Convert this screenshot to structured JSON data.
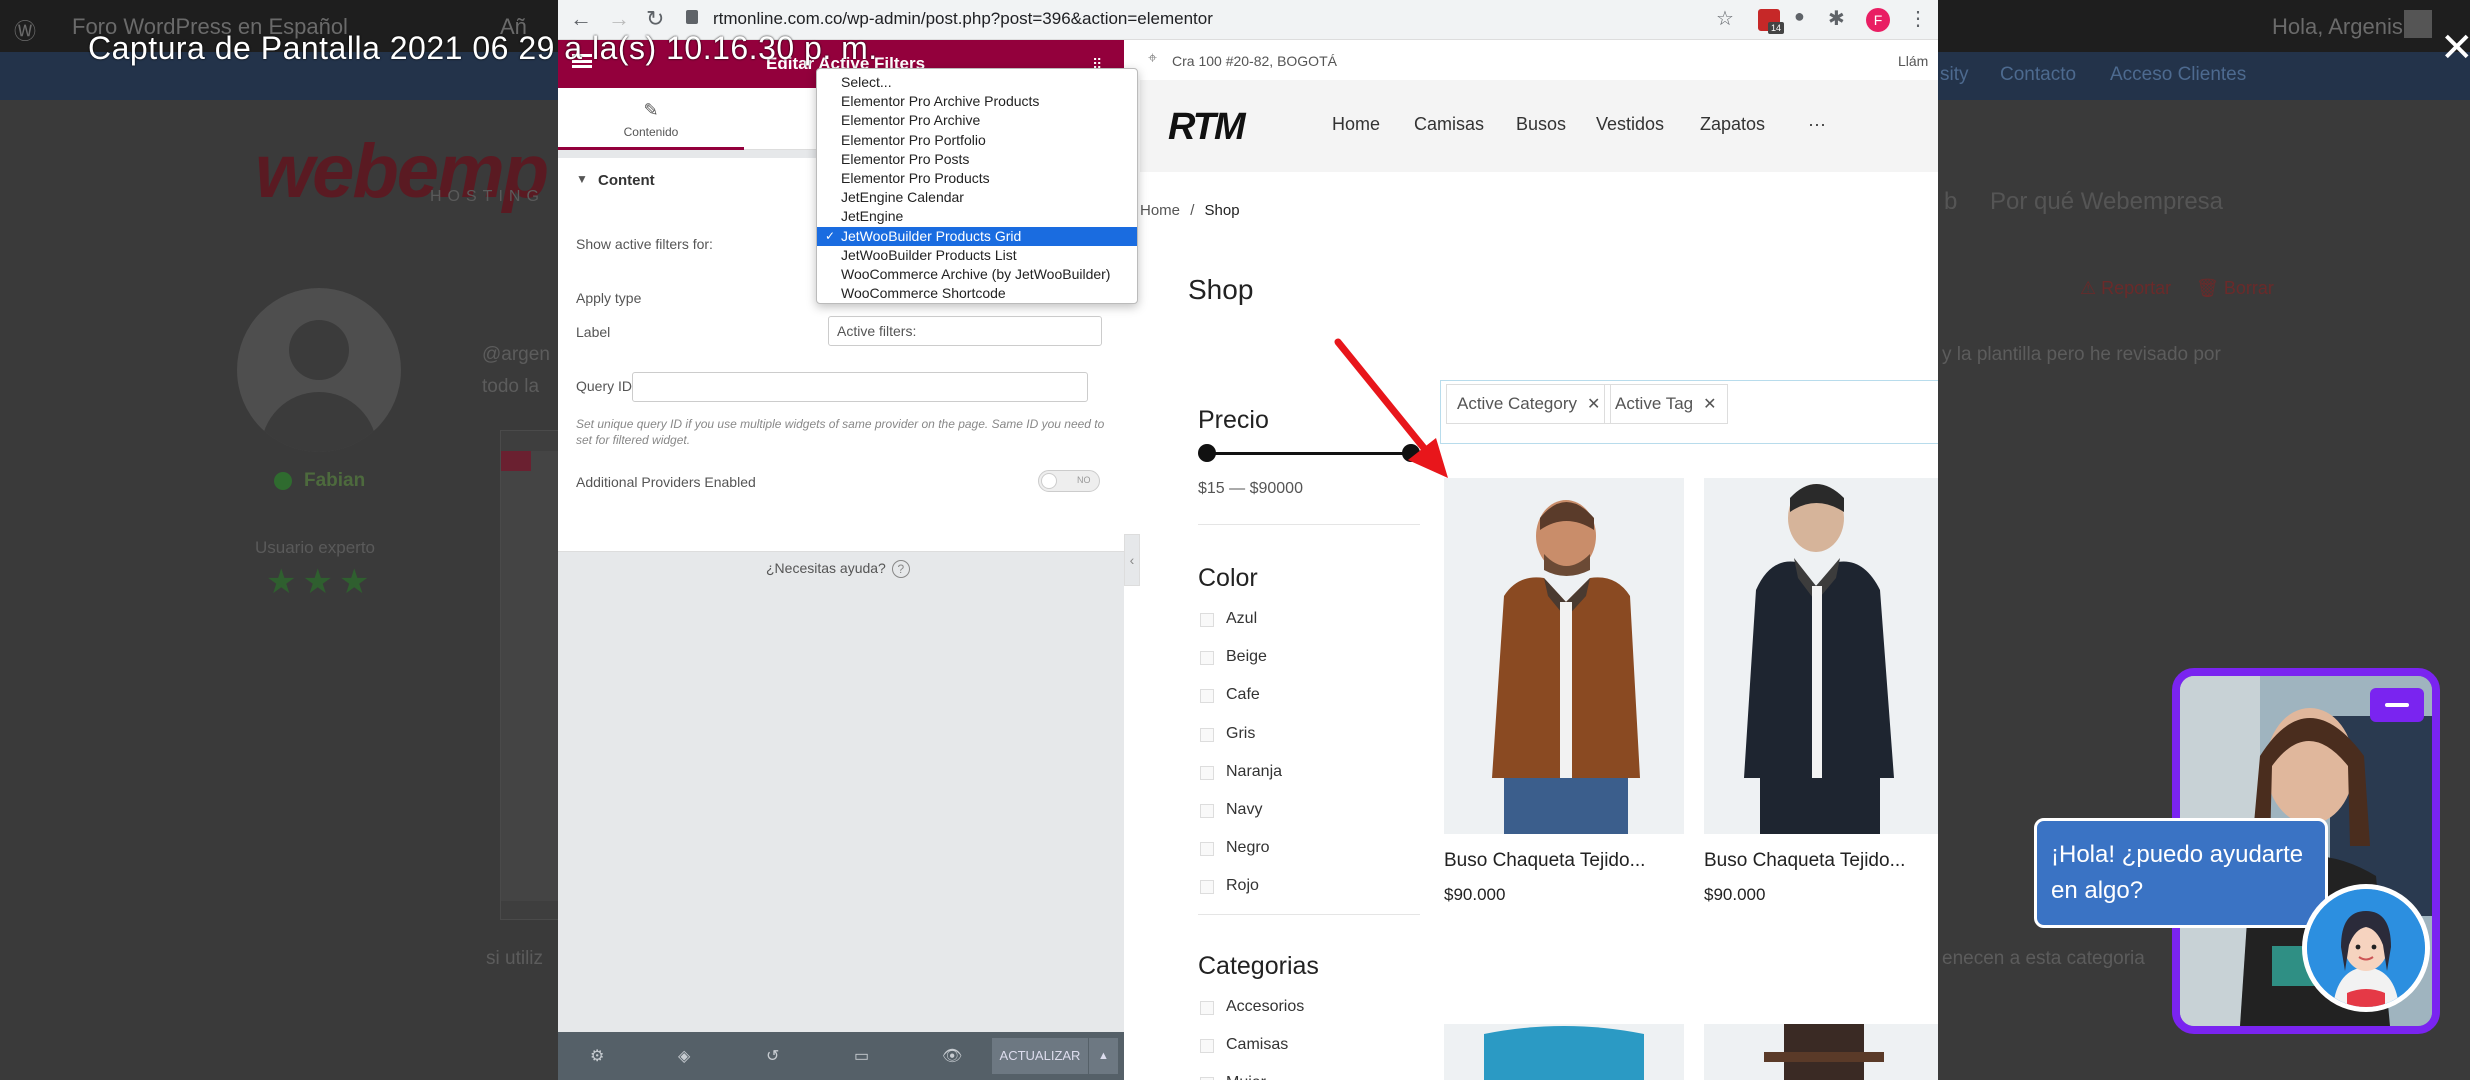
{
  "caption": "Captura de Pantalla 2021 06 29 a la(s) 10.16.30 p. m.",
  "background": {
    "wp_items": [
      "Foro WordPress en Español",
      "Añ"
    ],
    "greeting": "Hola, Argenis",
    "top_links": [
      "sity",
      "Contacto",
      "Acceso Clientes"
    ],
    "logo": "webemp",
    "logo_sub": "HOSTING",
    "menu_right": [
      "b",
      "Por qué Webempresa"
    ],
    "actions": [
      "Reportar",
      "Borrar"
    ],
    "author": "Fabian",
    "role": "Usuario experto",
    "stars": "★★★",
    "post_start": "@argen",
    "post_line2": "todo la",
    "post_right": "y la plantilla pero he revisado por",
    "post_bottom_left": "si utiliz",
    "post_bottom_right": "enecen a esta categoria"
  },
  "browser": {
    "url": "rtmonline.com.co/wp-admin/post.php?post=396&action=elementor"
  },
  "panel": {
    "title": "Editar Active Filters",
    "tab_content": "Contenido",
    "section": "Content",
    "show_active_filters_label": "Show active filters for:",
    "apply_type_label": "Apply type",
    "label_label": "Label",
    "label_value": "Active filters:",
    "query_id_label": "Query ID",
    "hint": "Set unique query ID if you use multiple widgets of same provider on the page. Same ID you need to set for filtered widget.",
    "additional_providers_label": "Additional Providers Enabled",
    "toggle_text": "NO",
    "help": "¿Necesitas ayuda?",
    "update": "ACTUALIZAR"
  },
  "dropdown": {
    "options": [
      "Select...",
      "Elementor Pro Archive Products",
      "Elementor Pro Archive",
      "Elementor Pro Portfolio",
      "Elementor Pro Posts",
      "Elementor Pro Products",
      "JetEngine Calendar",
      "JetEngine",
      "JetWooBuilder Products Grid",
      "JetWooBuilder Products List",
      "WooCommerce Archive (by JetWooBuilder)",
      "WooCommerce Shortcode"
    ],
    "selected_index": 8
  },
  "site": {
    "address": "Cra 100 #20-82, BOGOTÁ",
    "llame": "Llám",
    "brand": "RTM",
    "nav": [
      "Home",
      "Camisas",
      "Busos",
      "Vestidos",
      "Zapatos",
      "···"
    ],
    "breadcrumb_home": "Home",
    "breadcrumb_sep": "/",
    "breadcrumb_current": "Shop",
    "shop_title": "Shop",
    "price_title": "Precio",
    "price_range": "$15 — $90000",
    "color_title": "Color",
    "colors": [
      "Azul",
      "Beige",
      "Cafe",
      "Gris",
      "Naranja",
      "Navy",
      "Negro",
      "Rojo"
    ],
    "categories_title": "Categorias",
    "categories": [
      "Accesorios",
      "Camisas",
      "Mujer"
    ],
    "active_chips": [
      "Active Category",
      "Active Tag"
    ],
    "products": [
      {
        "name": "Buso Chaqueta Tejido...",
        "price": "$90.000"
      },
      {
        "name": "Buso Chaqueta Tejido...",
        "price": "$90.000"
      }
    ]
  },
  "chat": {
    "bubble": "¡Hola! ¿puedo ayudarte en algo?"
  },
  "colors": {
    "elementor_maroon": "#93003c",
    "selected_blue": "#1a6ce0",
    "chat_purple": "#7a24f0",
    "arrow_red": "#e8161b"
  }
}
